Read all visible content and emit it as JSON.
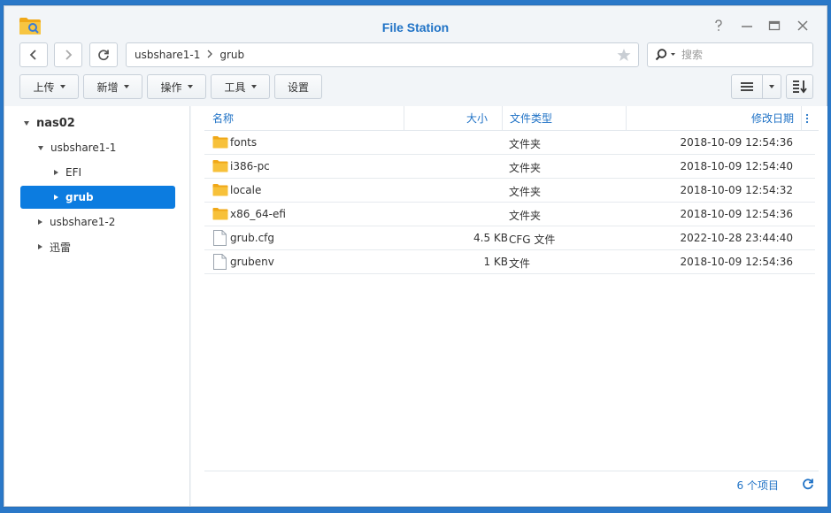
{
  "window": {
    "title": "File Station"
  },
  "colors": {
    "accent": "#1f72c6",
    "selection": "#0c7ce0",
    "folder": "#f5b82e"
  },
  "navigation": {
    "back_icon": "chevron-left-icon",
    "forward_icon": "chevron-right-icon",
    "refresh_icon": "refresh-icon"
  },
  "address": {
    "path": [
      "usbshare1-1",
      "grub"
    ]
  },
  "search": {
    "placeholder": "搜索"
  },
  "toolbar": {
    "upload": "上传",
    "create": "新增",
    "action": "操作",
    "tools": "工具",
    "settings": "设置"
  },
  "tree": {
    "root": "nas02",
    "share1": "usbshare1-1",
    "efi": "EFI",
    "grub": "grub",
    "share2": "usbshare1-2",
    "xunlei": "迅雷"
  },
  "columns": {
    "name": "名称",
    "size": "大小",
    "type": "文件类型",
    "modified": "修改日期"
  },
  "files": [
    {
      "name": "fonts",
      "size": "",
      "type": "文件夹",
      "modified": "2018-10-09 12:54:36",
      "kind": "folder"
    },
    {
      "name": "i386-pc",
      "size": "",
      "type": "文件夹",
      "modified": "2018-10-09 12:54:40",
      "kind": "folder"
    },
    {
      "name": "locale",
      "size": "",
      "type": "文件夹",
      "modified": "2018-10-09 12:54:32",
      "kind": "folder"
    },
    {
      "name": "x86_64-efi",
      "size": "",
      "type": "文件夹",
      "modified": "2018-10-09 12:54:36",
      "kind": "folder"
    },
    {
      "name": "grub.cfg",
      "size": "4.5 KB",
      "type": "CFG 文件",
      "modified": "2022-10-28 23:44:40",
      "kind": "file"
    },
    {
      "name": "grubenv",
      "size": "1 KB",
      "type": "文件",
      "modified": "2018-10-09 12:54:36",
      "kind": "file"
    }
  ],
  "footer": {
    "item_count": "6 个项目"
  }
}
